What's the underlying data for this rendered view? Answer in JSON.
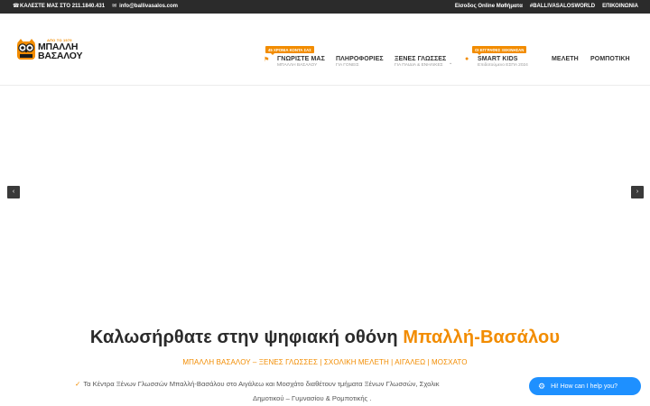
{
  "topbar": {
    "phone": "ΚΑΛΕΣΤΕ ΜΑΣ ΣΤΟ 211.1840.431",
    "email": "info@ballivasalos.com",
    "links": [
      "Είσοδος Online Μαθήματα",
      "#BALLIVASALOSWORLD",
      "ΕΠΙΚΟΙΝΩΝΙΑ"
    ]
  },
  "logo": {
    "small": "ΑΠΟ ΤΟ 1979",
    "line1": "ΜΠΑΛΛΗ",
    "line2": "ΒΑΣΑΛΟΥ"
  },
  "nav": {
    "items": [
      {
        "title": "ΓΝΩΡΙΣΤΕ ΜΑΣ",
        "sub": "ΜΠΑΛΛΗ ΒΑΣΑΛΟΥ",
        "badge": "45 ΧΡΟΝΙΑ ΚΟΝΤΑ ΣΑΣ"
      },
      {
        "title": "ΠΛΗΡΟΦΟΡΙΕΣ",
        "sub": "ΓΙΑ ΓΟΝΕΙΣ"
      },
      {
        "title": "ΞΕΝΕΣ ΓΛΩΣΣΕΣ",
        "sub": "ΓΙΑ ΠΑΙΔΙΑ & ΕΝΗΛΙΚΕΣ"
      },
      {
        "title": "SMART KIDS",
        "sub": "Επιδοτούμενο ΕΣΠΑ 2024",
        "badge": "ΟΙ ΕΓΓΡΑΦΕΣ ΞΕΚΙΝΗΣΑΝ"
      },
      {
        "title": "ΜΕΛΕΤΗ"
      },
      {
        "title": "ΡΟΜΠΟΤΙΚΗ"
      }
    ]
  },
  "slider": {
    "prev": "‹",
    "next": "›"
  },
  "welcome": {
    "text": "Καλωσήρθατε στην ψηφιακή οθόνη ",
    "highlight": "Μπαλλή-Βασάλου"
  },
  "tagline": "ΜΠΑΛΛΗ ΒΑΣΑΛΟΥ – ΞΕΝΕΣ ΓΛΩΣΣΕΣ | ΣΧΟΛΙΚΗ ΜΕΛΕΤΗ | ΑΙΓΑΛΕΩ | ΜΟΣΧΑΤΟ",
  "description": {
    "line1": "Τα Κέντρα Ξένων Γλωσσών Μπαλλή-Βασάλου στο Αιγάλεω και Μοσχάτο διαθέτουν τμήματα Ξένων Γλωσσών, Σχολικ",
    "line2": "Δημοτικού – Γυμνασίου & Ρομποτικής ."
  },
  "chat": {
    "label": "Hi! How can I help you?"
  },
  "colors": {
    "accent": "#f28c00",
    "topbar": "#2b2b2b",
    "chat": "#1e90ff"
  }
}
